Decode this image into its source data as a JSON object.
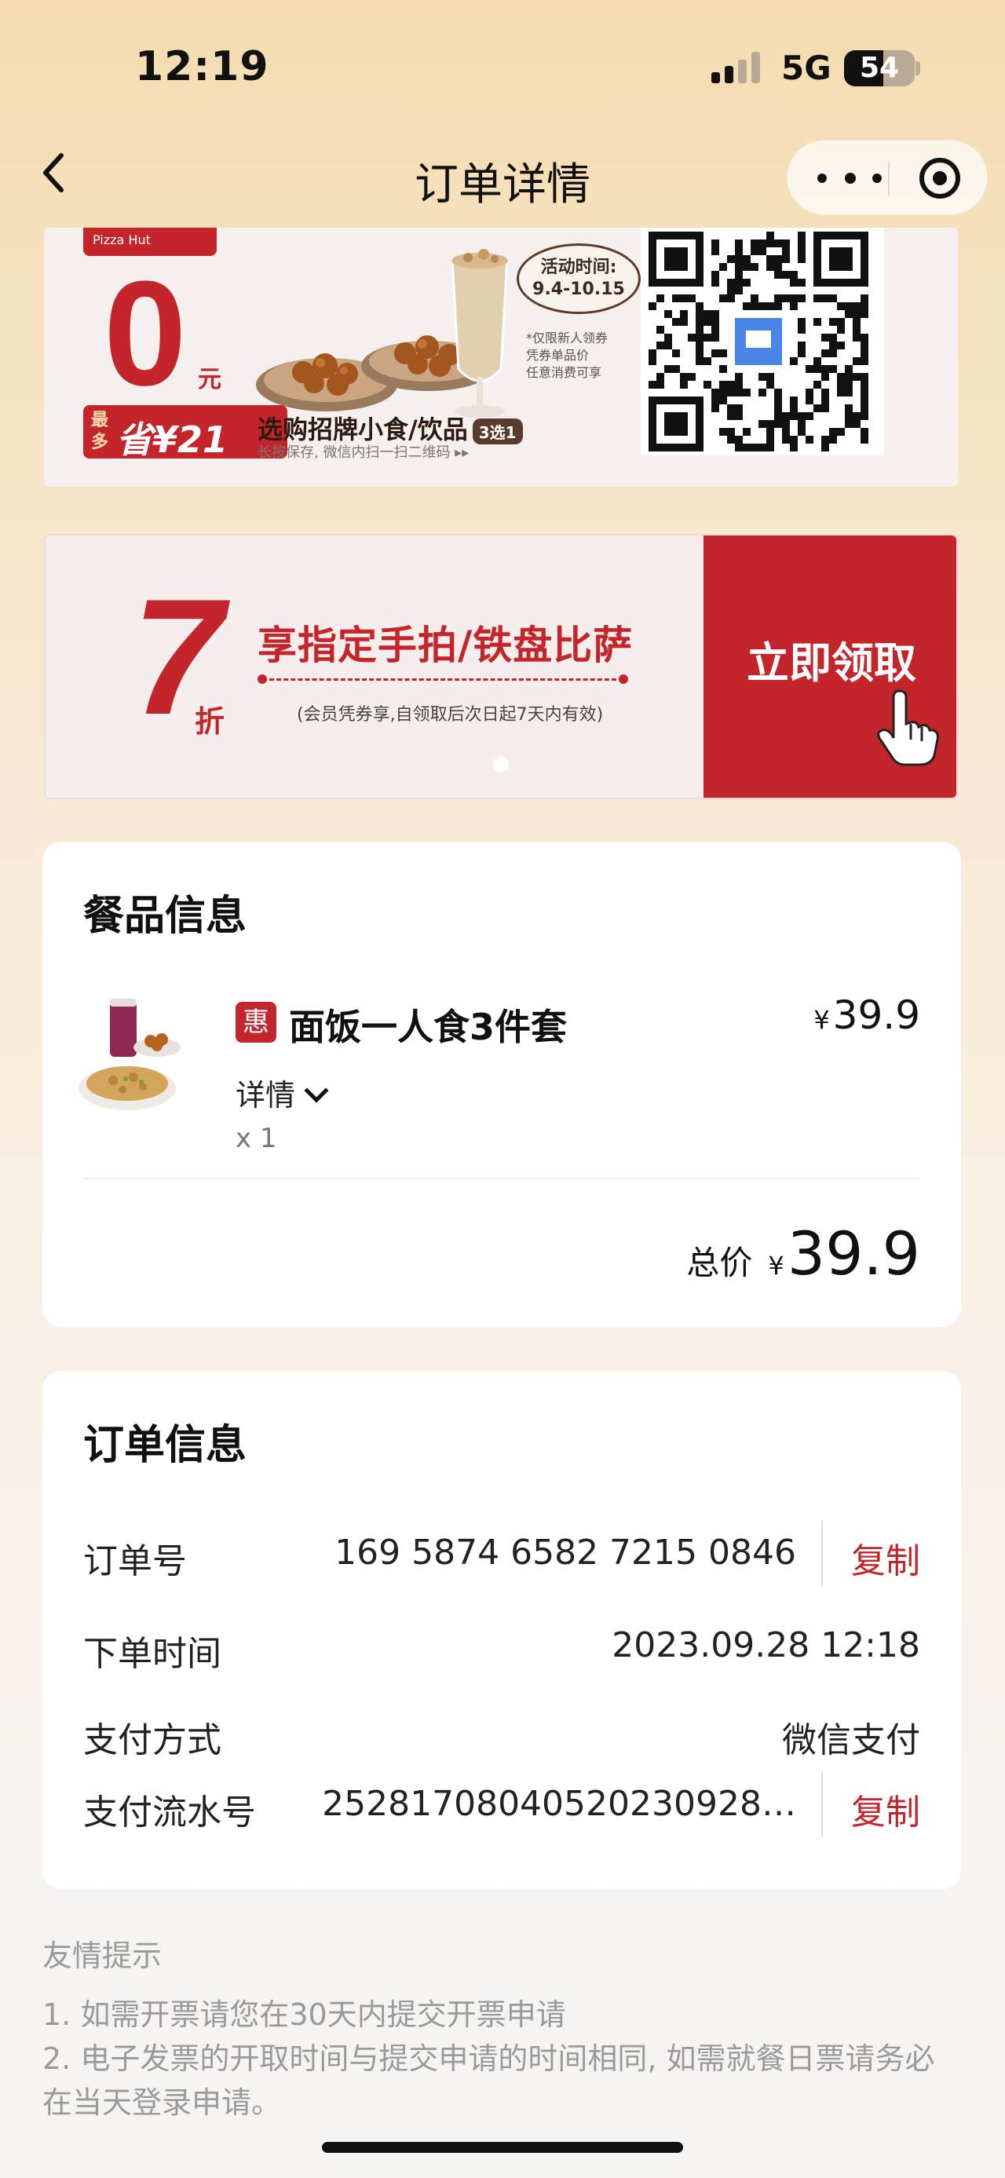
{
  "status_bar": {
    "time": "12:19",
    "network": "5G",
    "battery": "54"
  },
  "nav": {
    "title": "订单详情"
  },
  "banner_ad": {
    "brand": "Pizza Hut",
    "price": "0",
    "price_unit": "元",
    "save_prefix": "最多",
    "save_text": "省¥21",
    "activity_title": "活动时间:",
    "activity_dates": "9.4-10.15",
    "fine_print_1": "*仅限新人领券",
    "fine_print_2": "凭券单品价",
    "fine_print_3": "任意消费可享",
    "promo_title": "选购招牌小食/饮品",
    "promo_tag": "3选1",
    "promo_sub": "长按保存, 微信内扫一扫二维码 ▸▸"
  },
  "banner_coupon": {
    "discount": "7",
    "discount_unit": "折",
    "title": "享指定手拍/铁盘比萨",
    "subtitle": "(会员凭券享,自领取后次日起7天内有效)",
    "claim_label": "立即领取"
  },
  "food_info": {
    "title": "餐品信息",
    "item": {
      "badge": "惠",
      "name": "面饭一人食3件套",
      "price": "39.9",
      "currency": "¥",
      "detail_label": "详情",
      "quantity": "x 1"
    },
    "total_label": "总价",
    "total_currency": "¥",
    "total_amount": "39.9"
  },
  "order_info": {
    "title": "订单信息",
    "rows": [
      {
        "key": "订单号",
        "value": "169 5874 6582 7215 0846",
        "action": "复制"
      },
      {
        "key": "下单时间",
        "value": "2023.09.28 12:18"
      },
      {
        "key": "支付方式",
        "value": "微信支付"
      },
      {
        "key": "支付流水号",
        "value": "25281708040520230928…",
        "action": "复制"
      }
    ]
  },
  "tips": {
    "title": "友情提示",
    "lines": [
      "1. 如需开票请您在30天内提交开票申请",
      "2. 电子发票的开取时间与提交申请的时间相同, 如需就餐日票请务必",
      "在当天登录申请。"
    ]
  },
  "colors": {
    "brand_red": "#c3252a",
    "background_top": "#f5dcb0"
  }
}
